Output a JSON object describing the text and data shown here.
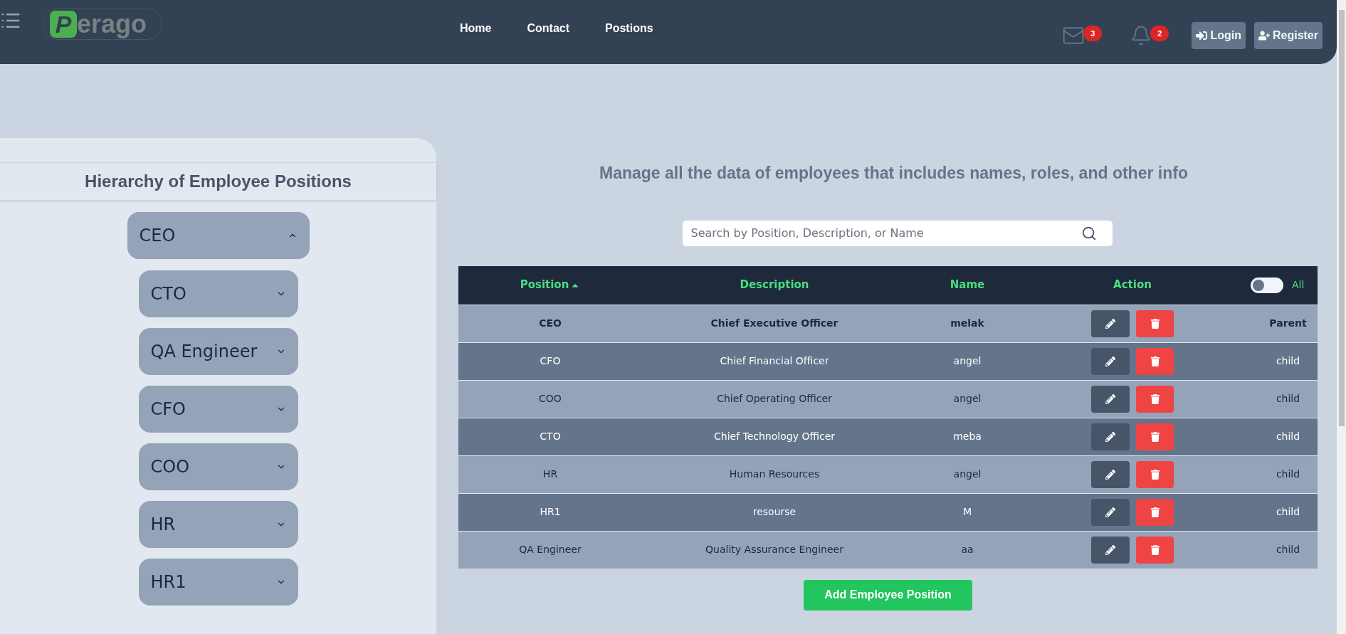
{
  "header": {
    "logo": {
      "letter": "P",
      "text": "erago"
    },
    "nav": [
      {
        "label": "Home"
      },
      {
        "label": "Contact"
      },
      {
        "label": "Postions"
      }
    ],
    "mail_count": "3",
    "notification_count": "2",
    "buttons": [
      {
        "kind": "login",
        "label": "Login"
      },
      {
        "kind": "register",
        "label": "Register"
      }
    ]
  },
  "hierarchy": {
    "title": "Hierarchy of Employee Positions",
    "tree": [
      {
        "label": "CEO",
        "expanded": true,
        "children": [
          {
            "label": "CTO",
            "expanded": false
          },
          {
            "label": "QA Engineer",
            "expanded": false
          },
          {
            "label": "CFO",
            "expanded": false
          },
          {
            "label": "COO",
            "expanded": false
          },
          {
            "label": "HR",
            "expanded": false
          },
          {
            "label": "HR1",
            "expanded": false
          }
        ]
      }
    ]
  },
  "main": {
    "heading": "Manage all the data of employees that includes names, roles, and other info",
    "search": {
      "placeholder": "Search by Position, Description, or Name"
    },
    "table": {
      "columns": [
        {
          "label": "Position",
          "sorted": true
        },
        {
          "label": "Description",
          "sorted": false
        },
        {
          "label": "Name",
          "sorted": false
        },
        {
          "label": "Action",
          "sorted": false
        }
      ],
      "toggle": {
        "label": "All",
        "on": false
      },
      "rows": [
        {
          "kind": "parent",
          "position": "CEO",
          "description": "Chief Executive Officer",
          "name": "melak",
          "type": "Parent"
        },
        {
          "kind": "child",
          "position": "CFO",
          "description": "Chief Financial Officer",
          "name": "angel",
          "type": "child"
        },
        {
          "kind": "child",
          "position": "COO",
          "description": "Chief Operating Officer",
          "name": "angel",
          "type": "child"
        },
        {
          "kind": "child",
          "position": "CTO",
          "description": "Chief Technology Officer",
          "name": "meba",
          "type": "child"
        },
        {
          "kind": "child",
          "position": "HR",
          "description": "Human Resources",
          "name": "angel",
          "type": "child"
        },
        {
          "kind": "child",
          "position": "HR1",
          "description": "resourse",
          "name": "M",
          "type": "child"
        },
        {
          "kind": "child",
          "position": "QA Engineer",
          "description": "Quality Assurance Engineer",
          "name": "aa",
          "type": "child"
        }
      ]
    },
    "add_button": "Add Employee Position"
  }
}
